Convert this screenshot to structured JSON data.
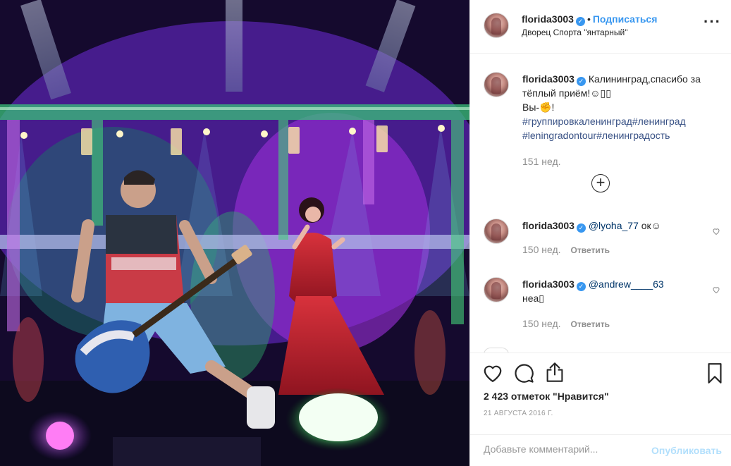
{
  "post": {
    "username": "florida3003",
    "follow_label": "Подписаться",
    "location": "Дворец Спорта \"янтарный\"",
    "more_icon": "more-horizontal-icon"
  },
  "caption": {
    "username": "florida3003",
    "text1": "Калининград,спасибо за тёплый приём!",
    "emoji1": "☺︎▯▯",
    "text2": "Вы-",
    "emoji2": "✊",
    "text3": "!",
    "tags": [
      "#группировкаленинград",
      "#ленинград",
      "#leningradontour",
      "#ленинградость"
    ],
    "time": "151 нед."
  },
  "load_more_icon": "plus-circle-icon",
  "comments": [
    {
      "username": "florida3003",
      "mention": "@lyoha_77",
      "text": " ок☺",
      "time": "150 нед.",
      "reply": "Ответить"
    },
    {
      "username": "florida3003",
      "mention": "@andrew____63",
      "text": "неа▯",
      "time": "150 нед.",
      "reply": "Ответить"
    }
  ],
  "actions": {
    "likes": "2 423 отметок \"Нравится\"",
    "date": "21 АВГУСТА 2016 Г."
  },
  "add_comment": {
    "placeholder": "Добавьте комментарий...",
    "publish_label": "Опубликовать"
  },
  "colors": {
    "accent": "#3897f0",
    "publish_disabled": "#b2dffc",
    "meta": "#8e8e8e"
  }
}
